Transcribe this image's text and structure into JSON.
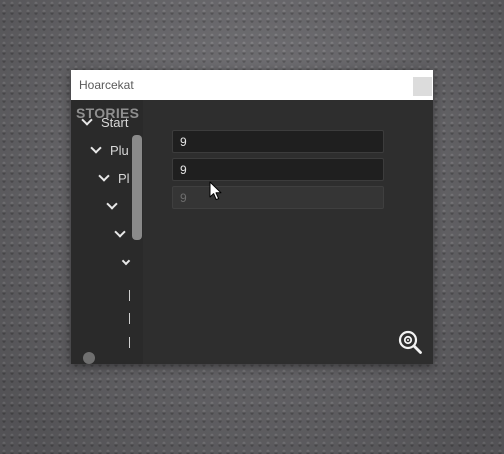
{
  "window": {
    "title": "Hoarcekat"
  },
  "sidebar": {
    "header": "STORIES",
    "tree": [
      {
        "label": "Start",
        "icon": "chevron-down-icon"
      },
      {
        "label": "Plu",
        "icon": "chevron-down-icon"
      },
      {
        "label": "Pl",
        "icon": "chevron-down-icon"
      },
      {
        "label": "",
        "icon": "chevron-down-icon"
      },
      {
        "label": "",
        "icon": "chevron-down-icon"
      },
      {
        "label": "",
        "icon": "chevron-down-icon"
      }
    ]
  },
  "main": {
    "fields": [
      {
        "value": "9",
        "state": "enabled"
      },
      {
        "value": "9",
        "state": "enabled"
      },
      {
        "value": "9",
        "state": "disabled"
      }
    ],
    "zoom_icon": "zoom-icon"
  },
  "colors": {
    "titlebar": "#ffffff",
    "panel": "#2e2e2e",
    "sidebar": "#2a2a2a",
    "field": "#1f1f1f",
    "scrollbar": "#8a8a8a",
    "backdrop": "#6f6e72"
  }
}
